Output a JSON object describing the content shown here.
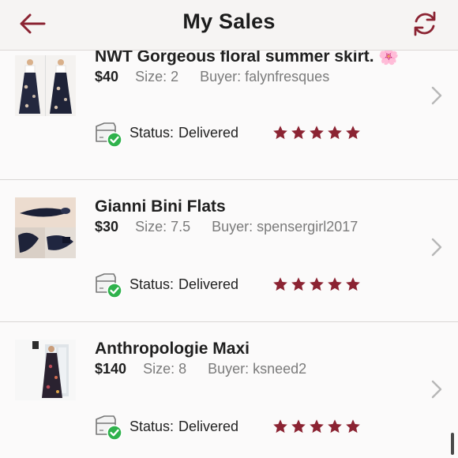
{
  "header": {
    "title": "My Sales"
  },
  "accent": "#8b2332",
  "success": "#2fb24c",
  "sales": [
    {
      "name": "NWT Gorgeous floral summer skirt.",
      "emoji": "🌸",
      "price": "$40",
      "size_label": "Size: 2",
      "buyer_label": "Buyer: falynfresques",
      "status_label": "Status:",
      "status_value": "Delivered",
      "rating": 5
    },
    {
      "name": "Gianni Bini Flats",
      "emoji": "",
      "price": "$30",
      "size_label": "Size: 7.5",
      "buyer_label": "Buyer: spensergirl2017",
      "status_label": "Status:",
      "status_value": "Delivered",
      "rating": 5
    },
    {
      "name": "Anthropologie Maxi",
      "emoji": "",
      "price": "$140",
      "size_label": "Size: 8",
      "buyer_label": "Buyer: ksneed2",
      "status_label": "Status:",
      "status_value": "Delivered",
      "rating": 5
    }
  ]
}
